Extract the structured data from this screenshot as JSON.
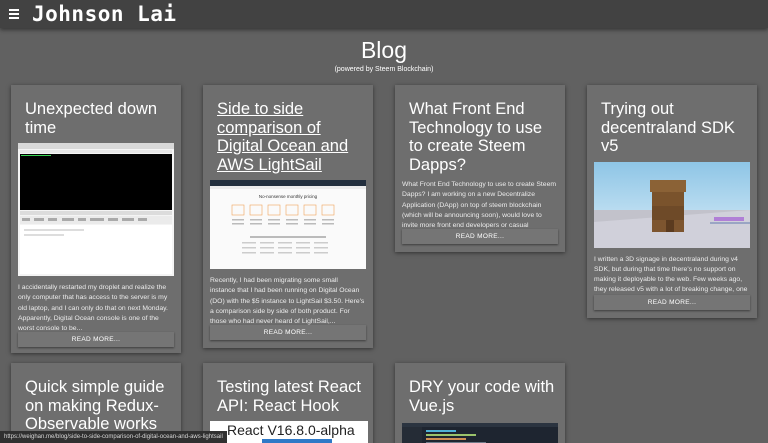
{
  "header": {
    "menu_icon": "hamburger-menu-icon",
    "site_title": "Johnson Lai"
  },
  "page": {
    "title": "Blog",
    "subtitle": "(powered by Steem Blockchain)"
  },
  "posts": [
    {
      "title": "Unexpected down time",
      "excerpt": "I accidentally restarted my droplet and realize the only computer that has access to the server is my old laptop, and I can only do that on next Monday. Apparently, Digital Ocean console is one of the worst console to be...",
      "read_more": "READ MORE..."
    },
    {
      "title": "Side to side comparison of Digital Ocean and AWS LightSail",
      "excerpt": "Recently, I had been migrating some small instance that I had been running on Digital Ocean (DO) with the $5 instance to LightSail $3.50. Here's a comparison side by side of both product. For those who had never heard of LightSail,...",
      "read_more": "READ MORE...",
      "image_heading": "No-nonsense monthly pricing"
    },
    {
      "title": "What Front End Technology to use to create Steem Dapps?",
      "excerpt": "What Front End Technology to use to create Steem Dapps? I am working on a new Decentralize Application (DApp) on top of steem blockchain (which will be announcing soon), would love to invite more front end developers or casual developer to...",
      "read_more": "READ MORE..."
    },
    {
      "title": "Trying out decentraland SDK v5",
      "excerpt": "I written a 3D signage in decentraland during v4 SDK, but during that time there's no support on making it deployable to the web. Few weeks ago, they released v5 with a lot of breaking change, one of it is that...",
      "read_more": "READ MORE..."
    },
    {
      "title": "Quick simple guide on making Redux-Observable works"
    },
    {
      "title": "Testing latest React API: React Hook",
      "image_text": "React V16.8.0-alpha"
    },
    {
      "title": "DRY your code with Vue.js"
    }
  ],
  "status": {
    "url": "https://weighan.me/blog/side-to-side-comparison-of-digital-ocean-and-aws-lightsail"
  }
}
